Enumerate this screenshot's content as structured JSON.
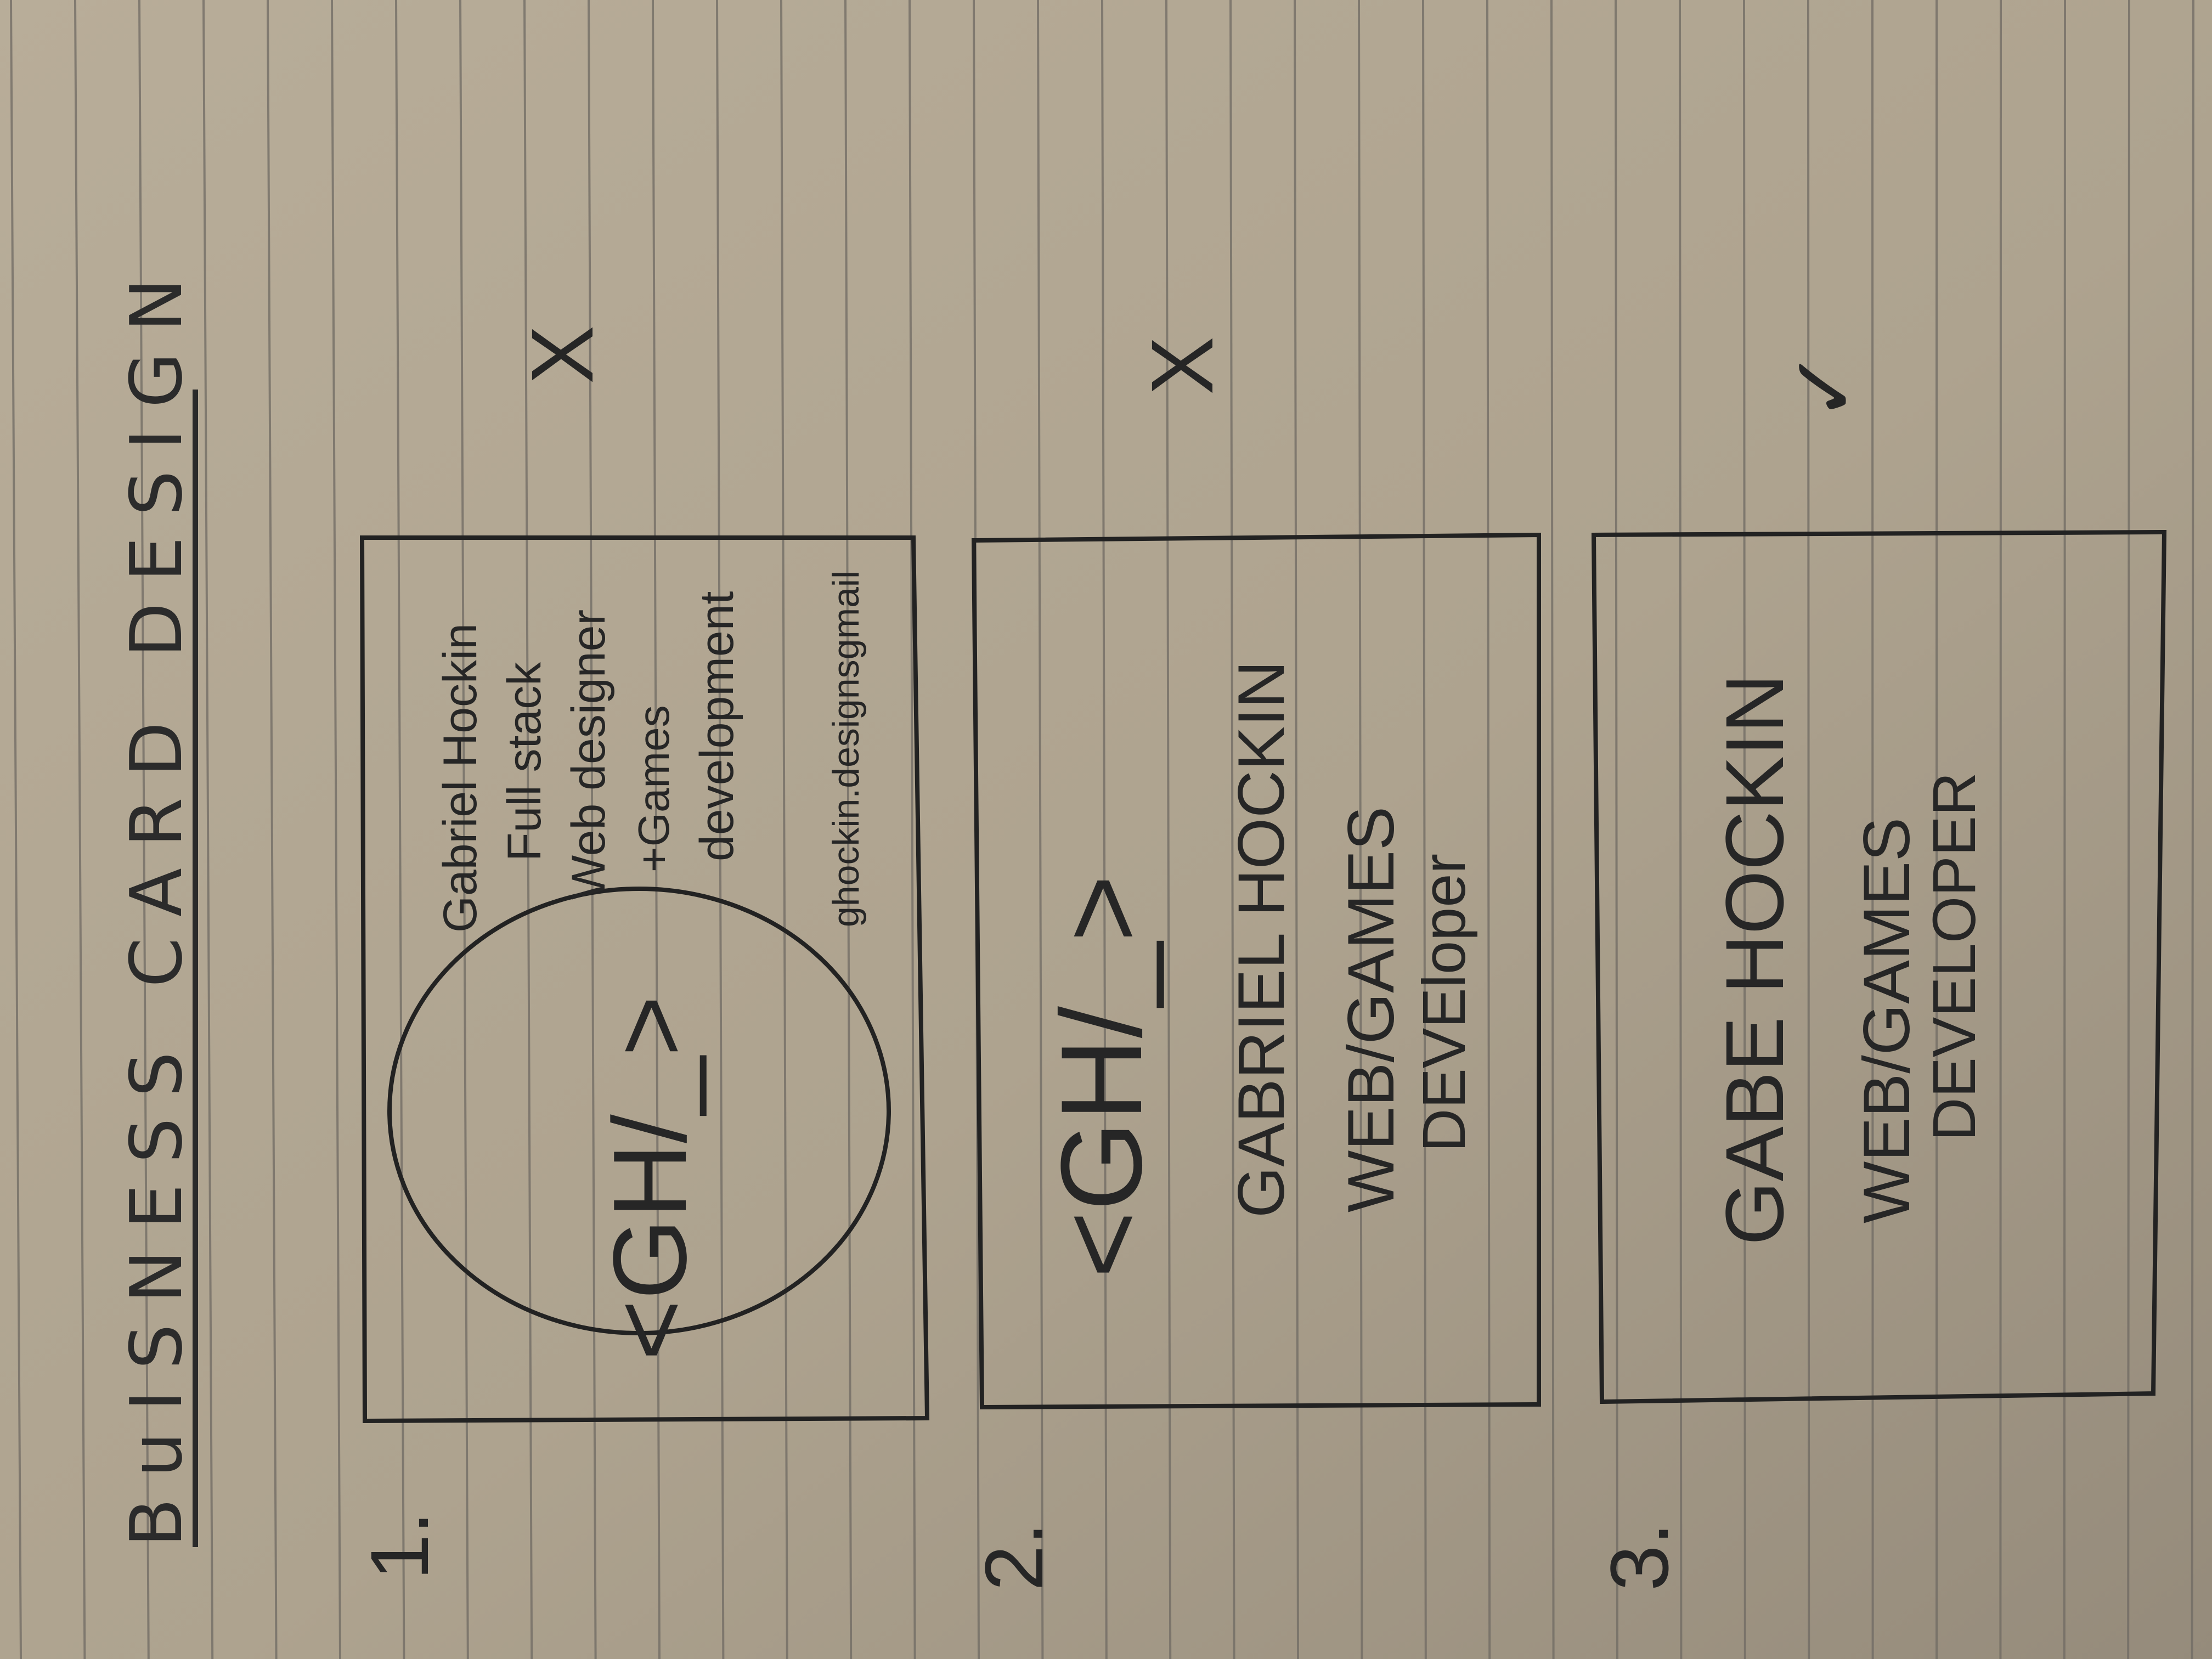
{
  "page": {
    "title": "BuISNESS CARD DESIGN"
  },
  "designs": [
    {
      "number": "1.",
      "mark": "X",
      "logo": "<GH/_>",
      "lines": [
        "Gabriel Hockin",
        "Full stack",
        "Web designer",
        "+Games",
        "development"
      ],
      "email": "ghockin.designsgmail"
    },
    {
      "number": "2.",
      "mark": "X",
      "logo": "<GH/_>",
      "lines": [
        "GABRIEL HOCKIN",
        "WEB/GAMES",
        "DEVEloper"
      ]
    },
    {
      "number": "3.",
      "mark": "✓",
      "lines": [
        "GABE HOCKIN",
        "WEB/GAMES",
        "DEVELOPER"
      ]
    }
  ],
  "colors": {
    "paper": "#b1a794",
    "rule": "#6f6a63",
    "ink": "#262626"
  }
}
